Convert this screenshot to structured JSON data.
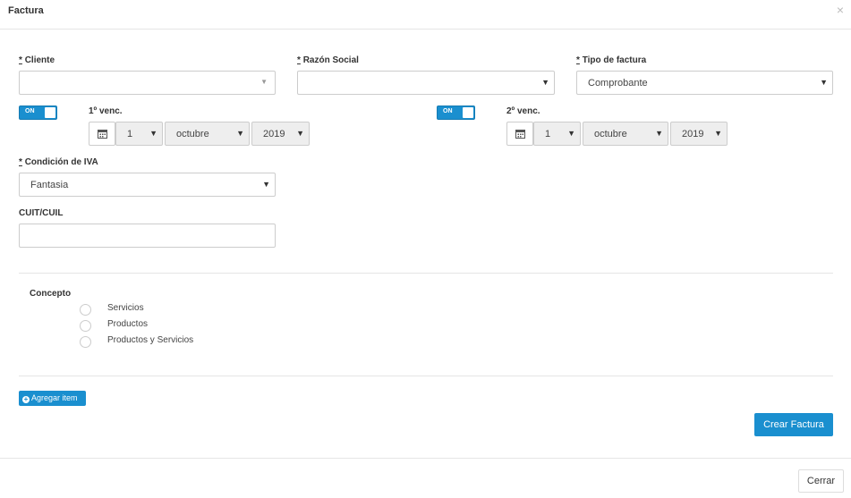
{
  "modal": {
    "title": "Factura",
    "close_glyph": "×"
  },
  "form": {
    "required_mark": "*",
    "cliente": {
      "label": "Cliente",
      "value": ""
    },
    "razon_social": {
      "label": "Razón Social",
      "value": ""
    },
    "tipo_factura": {
      "label": "Tipo de factura",
      "value": "Comprobante"
    },
    "venc1": {
      "toggle": "ON",
      "label": "1º venc.",
      "day": "1",
      "month": "octubre",
      "year": "2019"
    },
    "venc2": {
      "toggle": "ON",
      "label": "2º venc.",
      "day": "1",
      "month": "octubre",
      "year": "2019"
    },
    "condicion_iva": {
      "label": "Condición de IVA",
      "value": "Fantasia"
    },
    "cuit": {
      "label": "CUIT/CUIL",
      "value": ""
    },
    "concepto": {
      "label": "Concepto",
      "options": [
        "Servicios",
        "Productos",
        "Productos y Servicios"
      ]
    }
  },
  "actions": {
    "add_item": "Agregar item",
    "create": "Crear Factura",
    "close": "Cerrar"
  },
  "colors": {
    "primary": "#1a8fcf"
  }
}
